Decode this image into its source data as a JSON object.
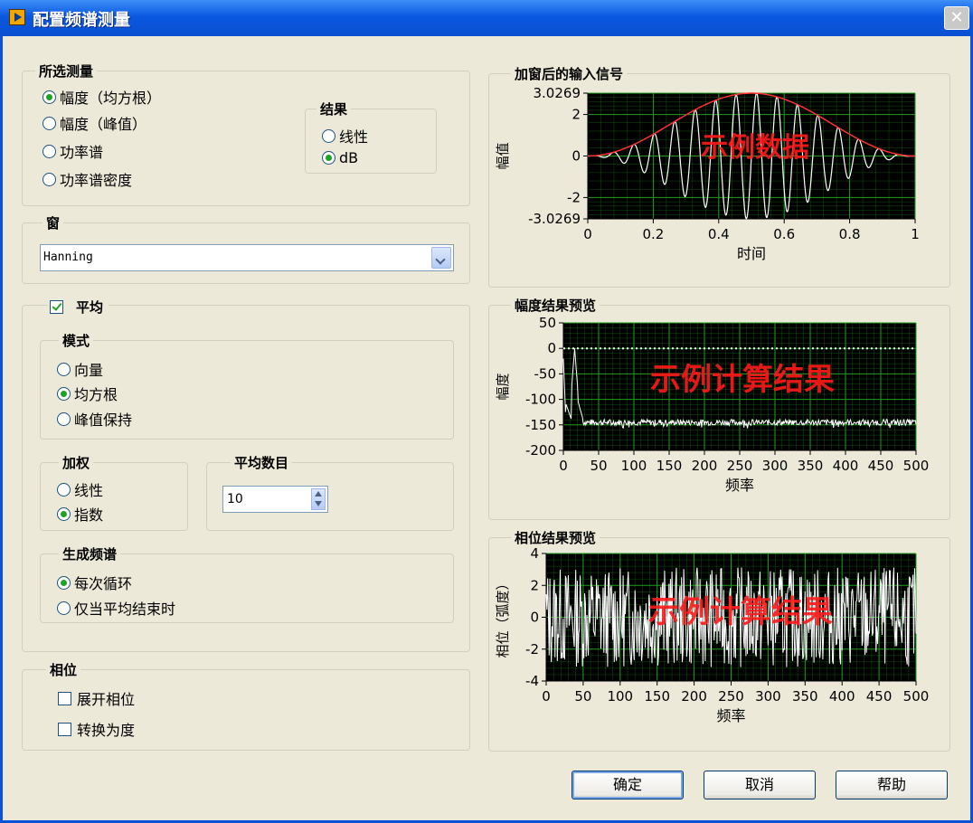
{
  "window": {
    "title": "配置频谱测量",
    "close_glyph": "✕"
  },
  "measurement": {
    "legend": "所选测量",
    "options": [
      "幅度（均方根）",
      "幅度（峰值）",
      "功率谱",
      "功率谱密度"
    ],
    "selected_index": 0
  },
  "result": {
    "legend": "结果",
    "options": [
      "线性",
      "dB"
    ],
    "selected_index": 1
  },
  "window_func": {
    "legend": "窗",
    "value": "Hanning"
  },
  "averaging": {
    "label": "平均",
    "enabled": true,
    "mode": {
      "legend": "模式",
      "options": [
        "向量",
        "均方根",
        "峰值保持"
      ],
      "selected_index": 1
    },
    "weighting": {
      "legend": "加权",
      "options": [
        "线性",
        "指数"
      ],
      "selected_index": 1
    },
    "count": {
      "legend": "平均数目",
      "value": "10"
    },
    "produce": {
      "legend": "生成频谱",
      "options": [
        "每次循环",
        "仅当平均结束时"
      ],
      "selected_index": 0
    }
  },
  "phase": {
    "legend": "相位",
    "options": [
      {
        "label": "展开相位",
        "checked": false
      },
      {
        "label": "转换为度",
        "checked": false
      }
    ]
  },
  "buttons": {
    "ok": "确定",
    "cancel": "取消",
    "help": "帮助"
  },
  "colors": {
    "plot_bg": "#000000",
    "grid": "#1f9e1f",
    "trace": "#ffffff",
    "envelope": "#ff3030",
    "watermark": "#ff1a1a"
  },
  "chart_data": [
    {
      "type": "line",
      "title": "加窗后的输入信号",
      "xlabel": "时间",
      "ylabel": "幅值",
      "xlim": [
        0,
        1
      ],
      "ylim": [
        -3.0269,
        3.0269
      ],
      "xticks": [
        "0",
        "0.2",
        "0.4",
        "0.6",
        "0.8",
        "1"
      ],
      "yticks": [
        "3.0269",
        "2",
        "0",
        "-2",
        "-3.0269"
      ],
      "annotation": "示例数据",
      "series": [
        {
          "kind": "hanning-windowed sine",
          "peak": 3.0269,
          "cycles": 16
        },
        {
          "kind": "hanning envelope",
          "peak": 3.0269
        }
      ]
    },
    {
      "type": "line",
      "title": "幅度结果预览",
      "xlabel": "频率",
      "ylabel": "幅度",
      "xlim": [
        0,
        500
      ],
      "ylim": [
        -200,
        50
      ],
      "xticks": [
        "0",
        "50",
        "100",
        "150",
        "200",
        "250",
        "300",
        "350",
        "400",
        "450",
        "500"
      ],
      "yticks": [
        "50",
        "0",
        "-50",
        "-100",
        "-150",
        "-200"
      ],
      "annotation": "示例计算结果",
      "series": [
        {
          "peak_at": 16,
          "peak_db": 0,
          "noise_floor_db": -145,
          "reference_db": 0
        }
      ]
    },
    {
      "type": "line",
      "title": "相位结果预览",
      "xlabel": "频率",
      "ylabel": "相位（弧度）",
      "xlim": [
        0,
        500
      ],
      "ylim": [
        -4,
        4
      ],
      "xticks": [
        "0",
        "50",
        "100",
        "150",
        "200",
        "250",
        "300",
        "350",
        "400",
        "450",
        "500"
      ],
      "yticks": [
        "4",
        "2",
        "0",
        "-2",
        "-4"
      ],
      "annotation": "示例计算结果",
      "series": [
        {
          "kind": "noise",
          "range": [
            -3.14,
            3.14
          ]
        }
      ]
    }
  ]
}
